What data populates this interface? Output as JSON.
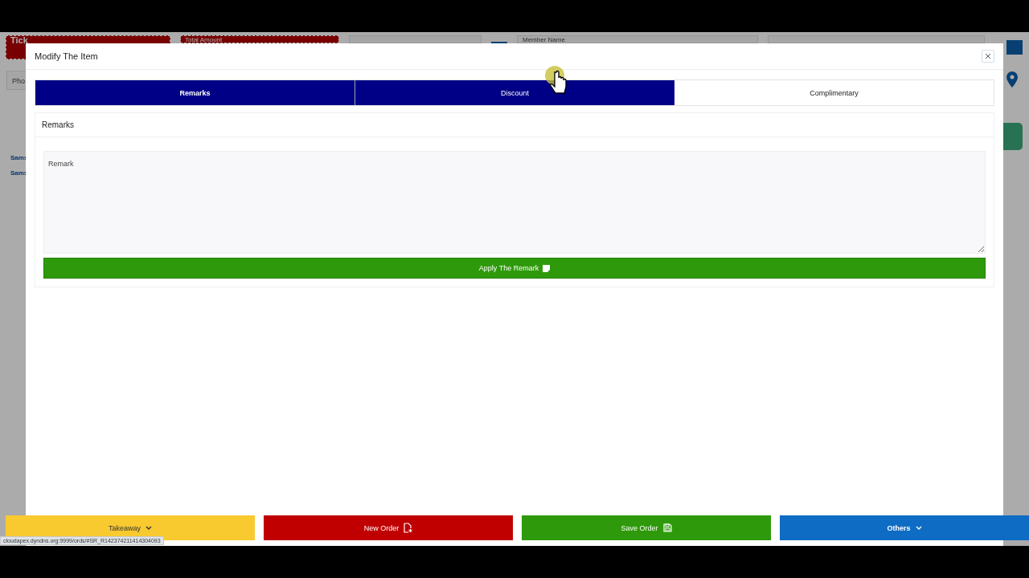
{
  "background": {
    "ticket_label": "Tick",
    "total_amount_label": "Total Amount",
    "member_name_label": "Member Name",
    "phone_label": "Pho",
    "links": [
      "Sams",
      "Sams"
    ]
  },
  "modal": {
    "title": "Modify The Item",
    "tabs": [
      {
        "label": "Remarks",
        "selected": true,
        "hovered": false
      },
      {
        "label": "Discount",
        "selected": false,
        "hovered": true
      },
      {
        "label": "Complimentary",
        "selected": false,
        "hovered": false
      }
    ],
    "section_title": "Remarks",
    "remark_field": {
      "placeholder": "Remark"
    },
    "apply_button": "Apply The Remark"
  },
  "action_bar": [
    {
      "label": "Takeaway",
      "kind": "dropdown",
      "color": "#f9c930",
      "emphasized": false
    },
    {
      "label": "New Order",
      "kind": "new-file",
      "color": "#c00000",
      "emphasized": false
    },
    {
      "label": "Save Order",
      "kind": "save",
      "color": "#2e9a0b",
      "emphasized": false
    },
    {
      "label": "Others",
      "kind": "dropdown",
      "color": "#0f6cc4",
      "emphasized": true
    }
  ],
  "status_bar": {
    "url": "cloudapex.dyndns.org:9999/ords/#SR_R142374211414304093"
  }
}
